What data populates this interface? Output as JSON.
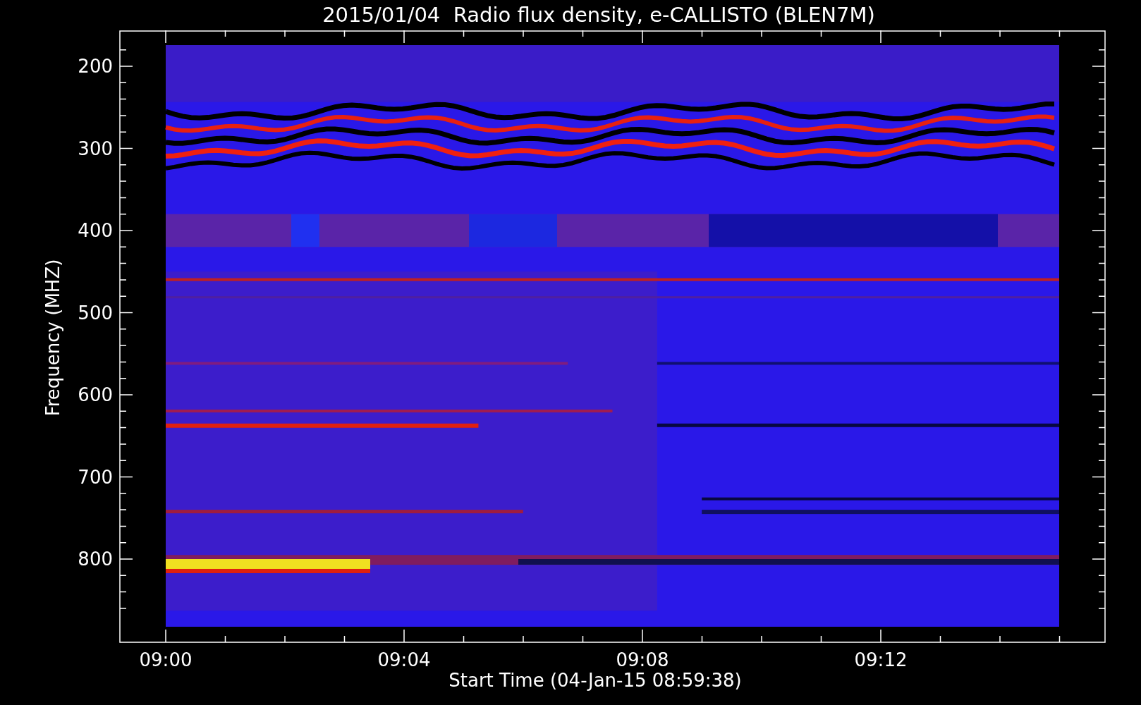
{
  "title": "2015/01/04  Radio flux density, e-CALLISTO (BLEN7M)",
  "y_axis": {
    "label": "Frequency (MHZ)",
    "ticks": [
      "200",
      "300",
      "400",
      "500",
      "600",
      "700",
      "800"
    ]
  },
  "x_axis": {
    "label": "Start Time (04-Jan-15 08:59:38)",
    "ticks": [
      "09:00",
      "09:04",
      "09:08",
      "09:12"
    ]
  }
}
